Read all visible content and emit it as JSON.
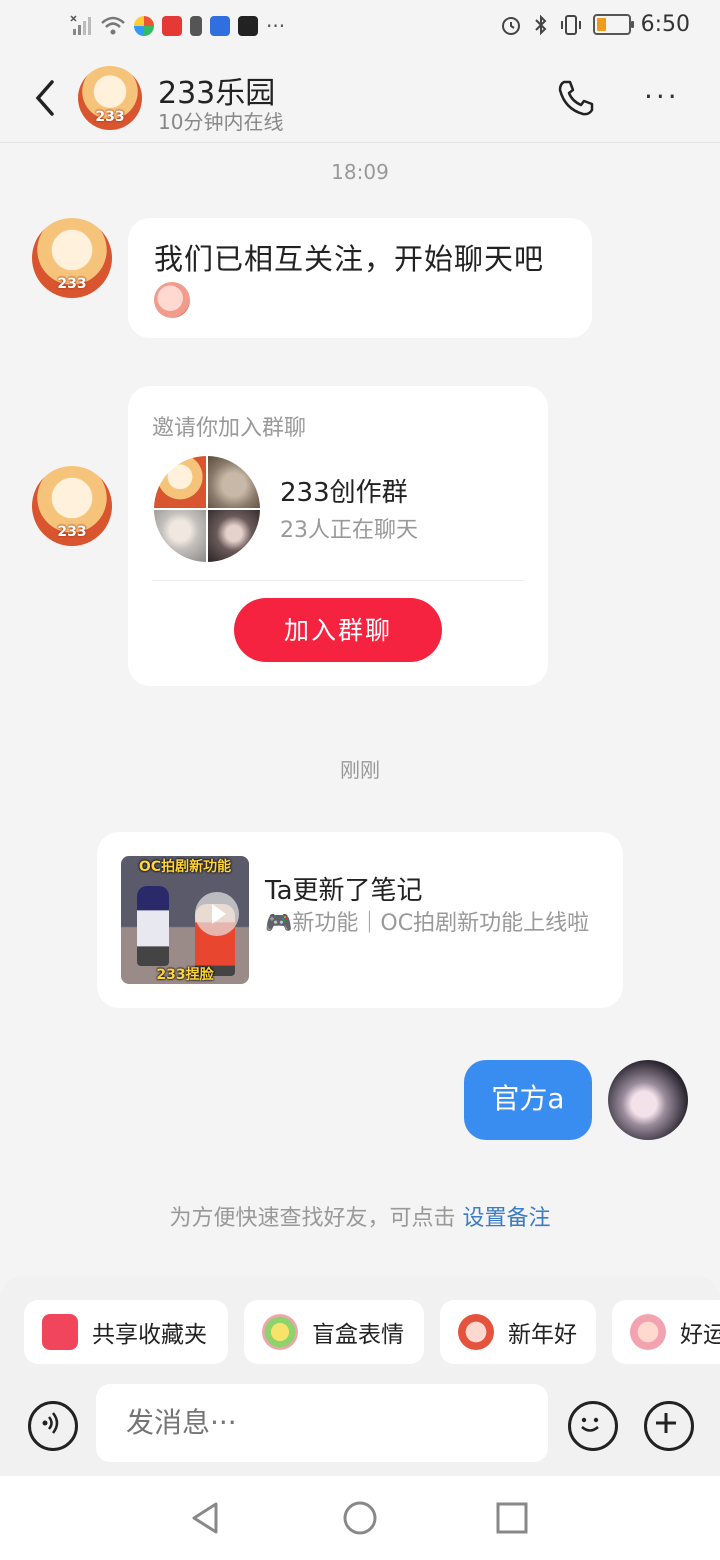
{
  "status_bar": {
    "time": "6:50",
    "left_icons": [
      "signal-off-icon",
      "wifi-icon",
      "app-icon-1",
      "app-icon-2",
      "app-icon-3",
      "app-icon-4",
      "app-icon-5"
    ],
    "more_indicator": "···",
    "right_icons": [
      "alarm-icon",
      "bluetooth-icon",
      "vibrate-icon",
      "battery-icon"
    ]
  },
  "header": {
    "title": "233乐园",
    "subtitle": "10分钟内在线",
    "more": "···"
  },
  "messages": {
    "time1": "18:09",
    "welcome_text": "我们已相互关注，开始聊天吧",
    "invite": {
      "title": "邀请你加入群聊",
      "group_name": "233创作群",
      "group_count": "23人正在聊天",
      "join_label": "加入群聊"
    },
    "time2": "刚刚",
    "note": {
      "title": "Ta更新了笔记",
      "desc": "🎮新功能｜OC拍剧新功能上线啦",
      "thumb_top": "OC拍剧新功能",
      "thumb_bottom": "233捏脸"
    },
    "mine_text": "官方a"
  },
  "hint": {
    "text": "为方便快速查找好友，可点击 ",
    "link": "设置备注"
  },
  "quick_actions": [
    {
      "label": "共享收藏夹",
      "icon": "folder-star-icon",
      "color": "#f0455a"
    },
    {
      "label": "盲盒表情",
      "icon": "blind-box-icon",
      "color": "#8ed36c"
    },
    {
      "label": "新年好",
      "icon": "new-year-icon",
      "color": "#e5533d"
    },
    {
      "label": "好运",
      "icon": "good-luck-icon",
      "color": "#f3a3b0"
    }
  ],
  "input": {
    "placeholder": "发消息···"
  },
  "colors": {
    "accent_red": "#f5233f",
    "bubble_blue": "#3a8df0",
    "link_blue": "#3a7cc6"
  }
}
